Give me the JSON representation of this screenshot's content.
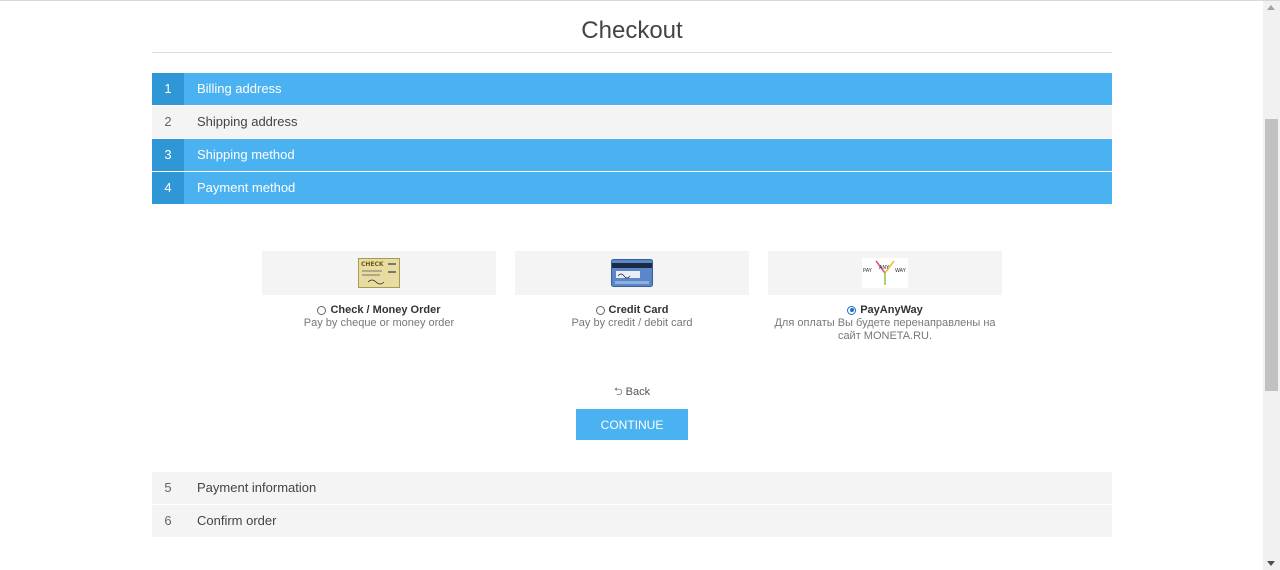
{
  "page": {
    "title": "Checkout"
  },
  "steps_top": [
    {
      "num": "1",
      "label": "Billing address",
      "state": "active"
    },
    {
      "num": "2",
      "label": "Shipping address",
      "state": "inactive"
    },
    {
      "num": "3",
      "label": "Shipping method",
      "state": "active"
    },
    {
      "num": "4",
      "label": "Payment method",
      "state": "active"
    }
  ],
  "payment_methods": [
    {
      "name": "Check / Money Order",
      "description": "Pay by cheque or money order",
      "selected": false,
      "logo": "check-logo",
      "logo_text": "CHECK"
    },
    {
      "name": "Credit Card",
      "description": "Pay by credit / debit card",
      "selected": false,
      "logo": "credit-card-logo"
    },
    {
      "name": "PayAnyWay",
      "description": "Для оплаты Вы будете перенаправлены на сайт MONETA.RU.",
      "selected": true,
      "logo": "payanyway-logo",
      "logo_text": [
        "PAY",
        "ANY",
        "WAY"
      ]
    }
  ],
  "actions": {
    "back_label": "Back",
    "continue_label": "CONTINUE"
  },
  "steps_bottom": [
    {
      "num": "5",
      "label": "Payment information",
      "state": "inactive"
    },
    {
      "num": "6",
      "label": "Confirm order",
      "state": "inactive"
    }
  ],
  "colors": {
    "accent": "#4ab2f1",
    "accent_dark": "#2f97d6",
    "inactive_bg": "#f4f4f4"
  }
}
